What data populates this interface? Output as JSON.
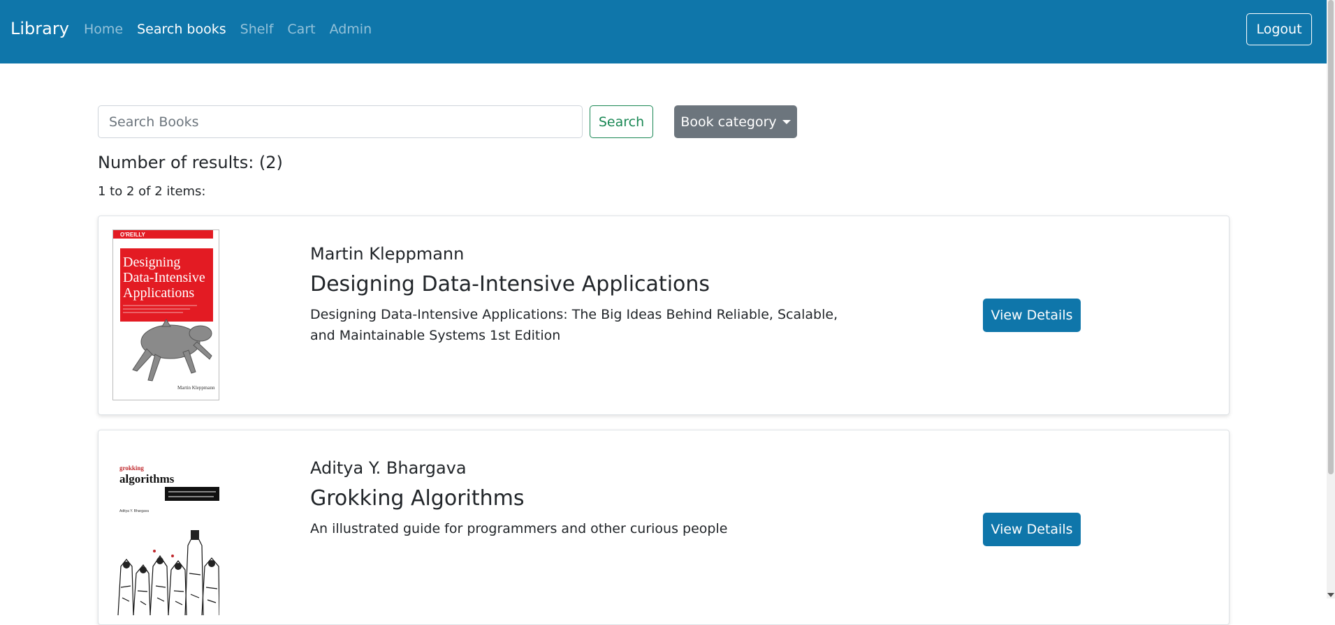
{
  "nav": {
    "brand": "Library",
    "links": [
      "Home",
      "Search books",
      "Shelf",
      "Cart",
      "Admin"
    ],
    "active": "Search books",
    "logout_label": "Logout"
  },
  "search": {
    "placeholder": "Search Books",
    "button_label": "Search",
    "category_label": "Book category"
  },
  "results": {
    "count_text": "Number of results: (2)",
    "range_text": "1 to 2 of 2 items:"
  },
  "books": [
    {
      "author": "Martin Kleppmann",
      "title": "Designing Data-Intensive Applications",
      "description": "Designing Data-Intensive Applications: The Big Ideas Behind Reliable, Scalable, and Maintainable Systems 1st Edition",
      "button_label": "View Details",
      "cover": {
        "publisher": "O'REILLY",
        "title_lines": [
          "Designing",
          "Data-Intensive",
          "Applications"
        ],
        "author": "Martin Kleppmann"
      }
    },
    {
      "author": "Aditya Y. Bhargava",
      "title": "Grokking Algorithms",
      "description": "An illustrated guide for programmers and other curious people",
      "button_label": "View Details",
      "cover": {
        "brand": "grokking",
        "title": "algorithms",
        "subtitle": "An illustrated guide for programmers and other curious people",
        "author": "Aditya Y. Bhargava"
      }
    }
  ],
  "colors": {
    "navbar": "#0f76aa",
    "primary_button": "#0f76aa",
    "search_button": "#198754",
    "category_button": "#6c757d",
    "oreilly_red": "#e31b23"
  }
}
